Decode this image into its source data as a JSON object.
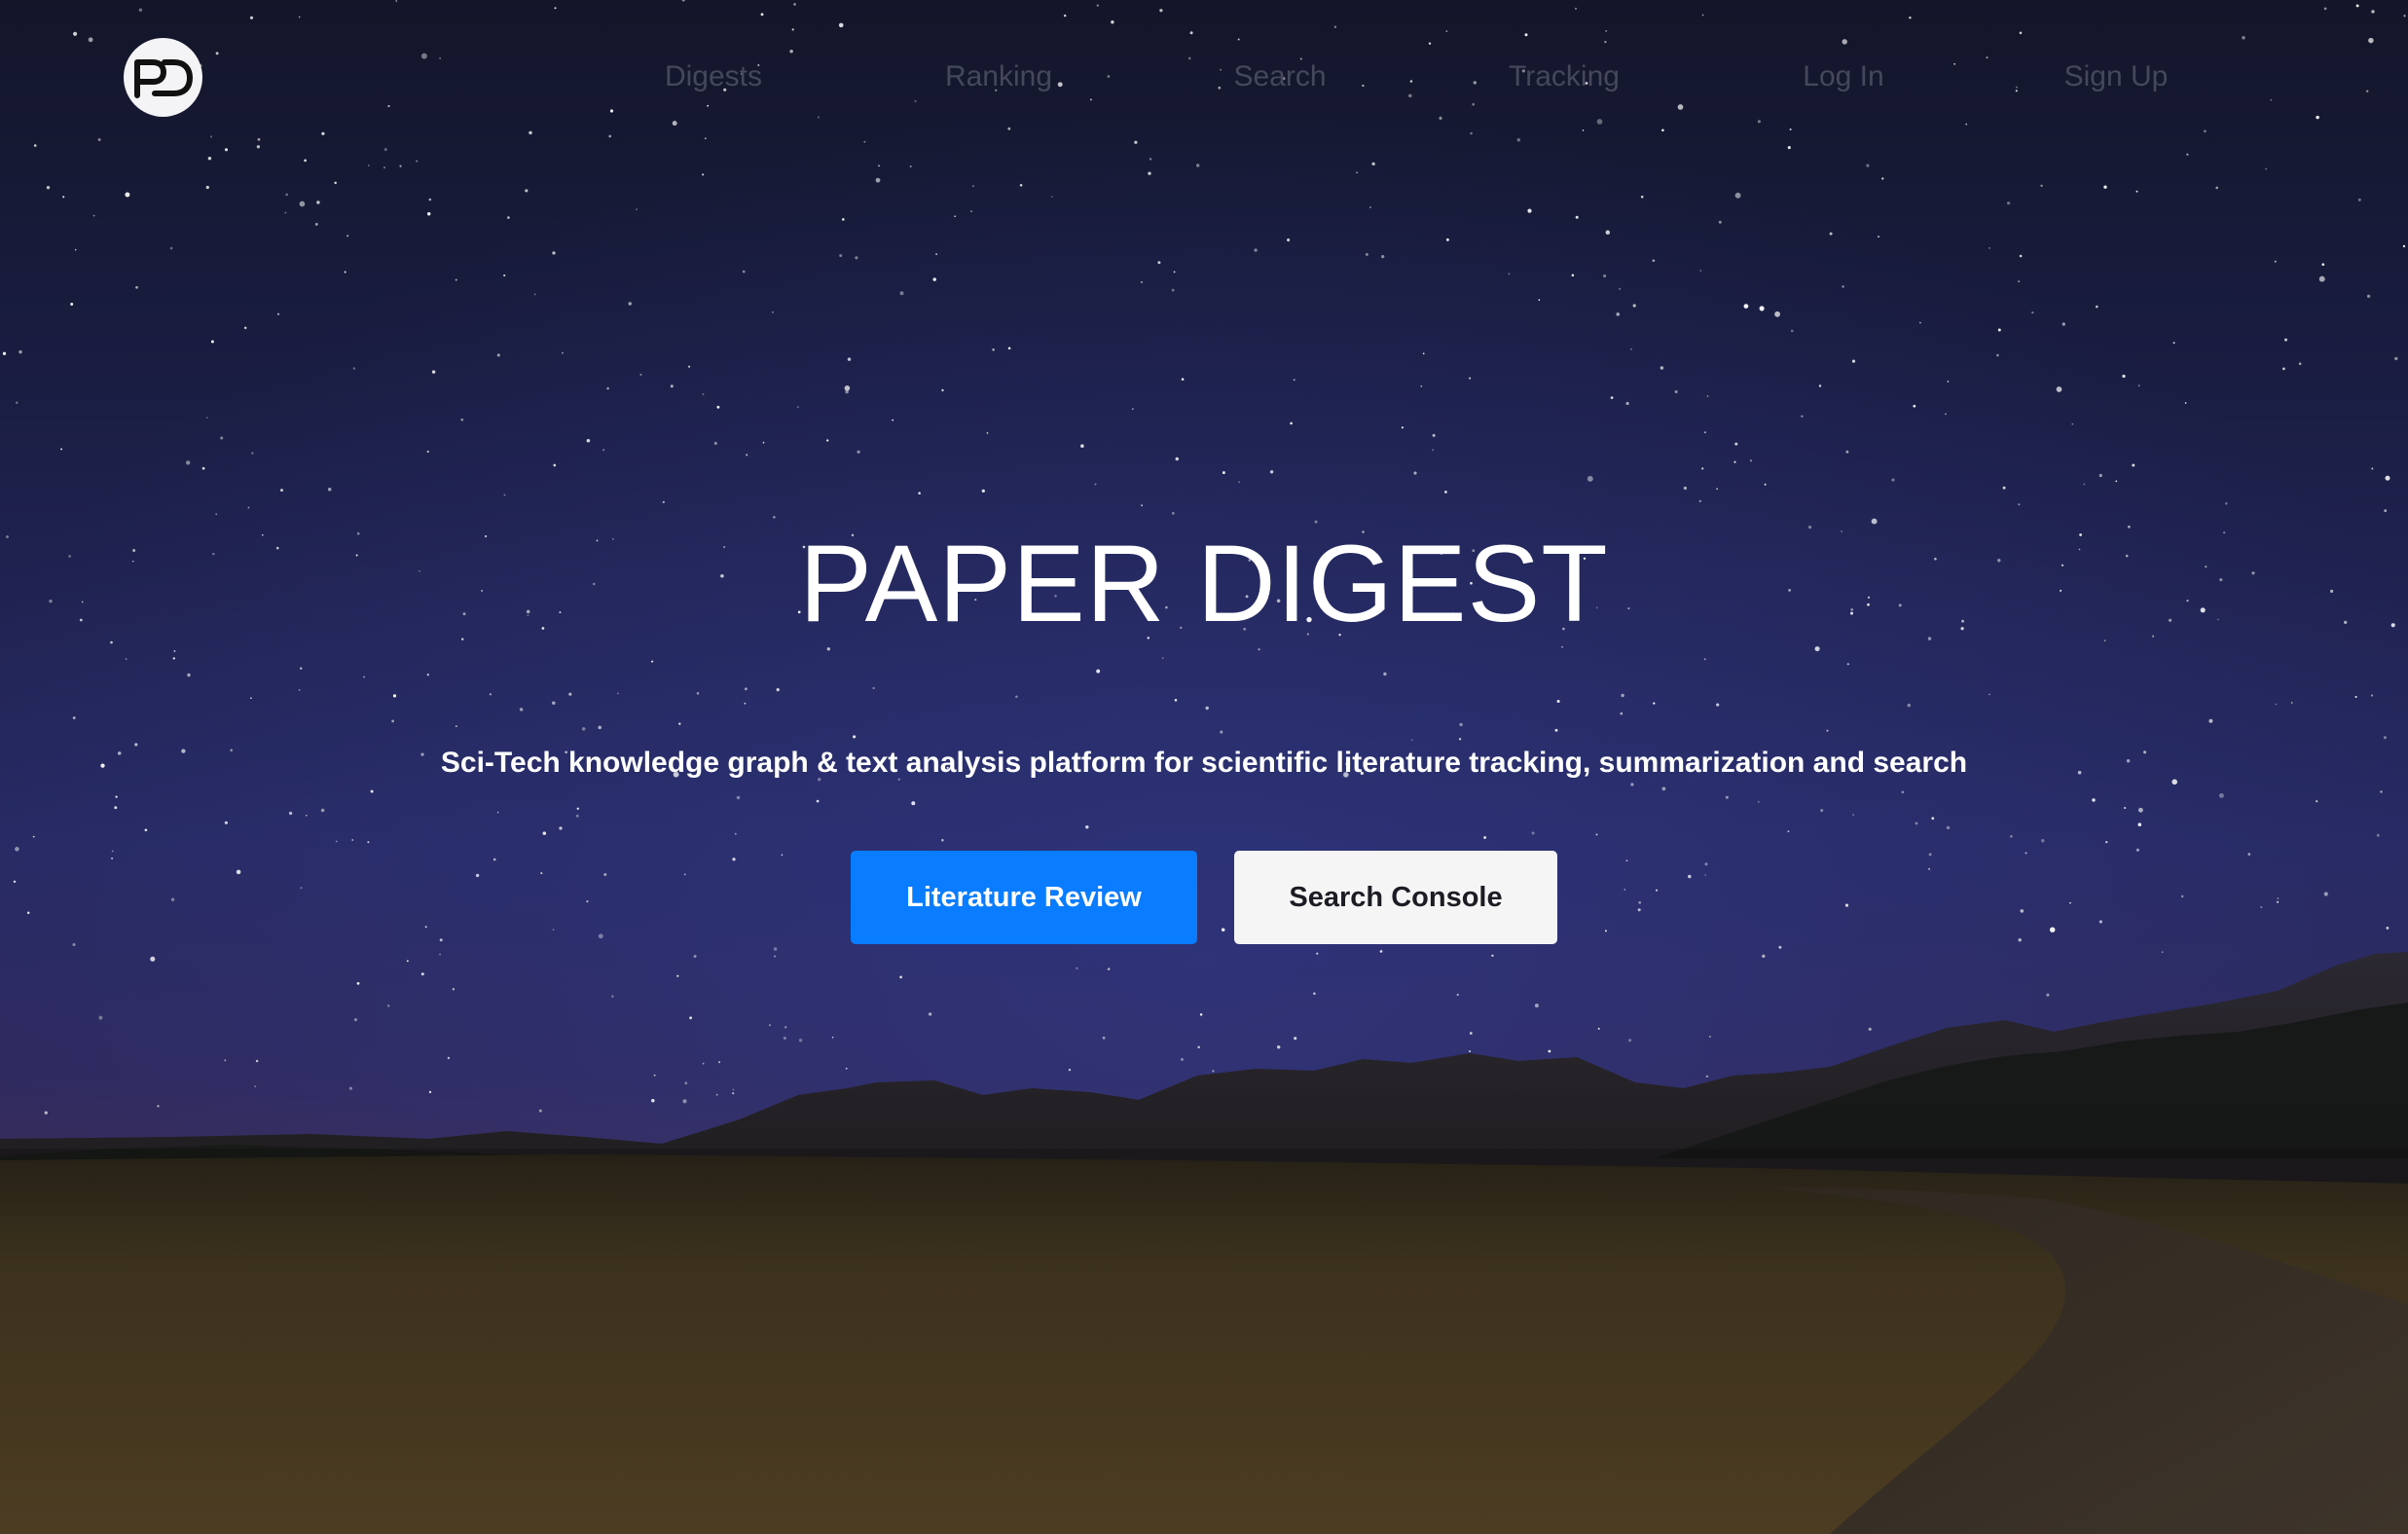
{
  "header": {
    "logo_icon": "pd-logo-icon",
    "nav": [
      {
        "label": "Digests"
      },
      {
        "label": "Ranking"
      },
      {
        "label": "Search"
      },
      {
        "label": "Tracking"
      },
      {
        "label": "Log In"
      },
      {
        "label": "Sign Up"
      }
    ]
  },
  "hero": {
    "title": "PAPER DIGEST",
    "subtitle": "Sci-Tech knowledge graph & text analysis platform for scientific literature tracking, summarization and search",
    "primary_button": "Literature Review",
    "secondary_button": "Search Console"
  },
  "colors": {
    "accent": "#0a7cff",
    "nav_text": "#45485c",
    "sky_top": "#14182f",
    "sky_mid": "#272a63",
    "field": "#4a3d24"
  }
}
